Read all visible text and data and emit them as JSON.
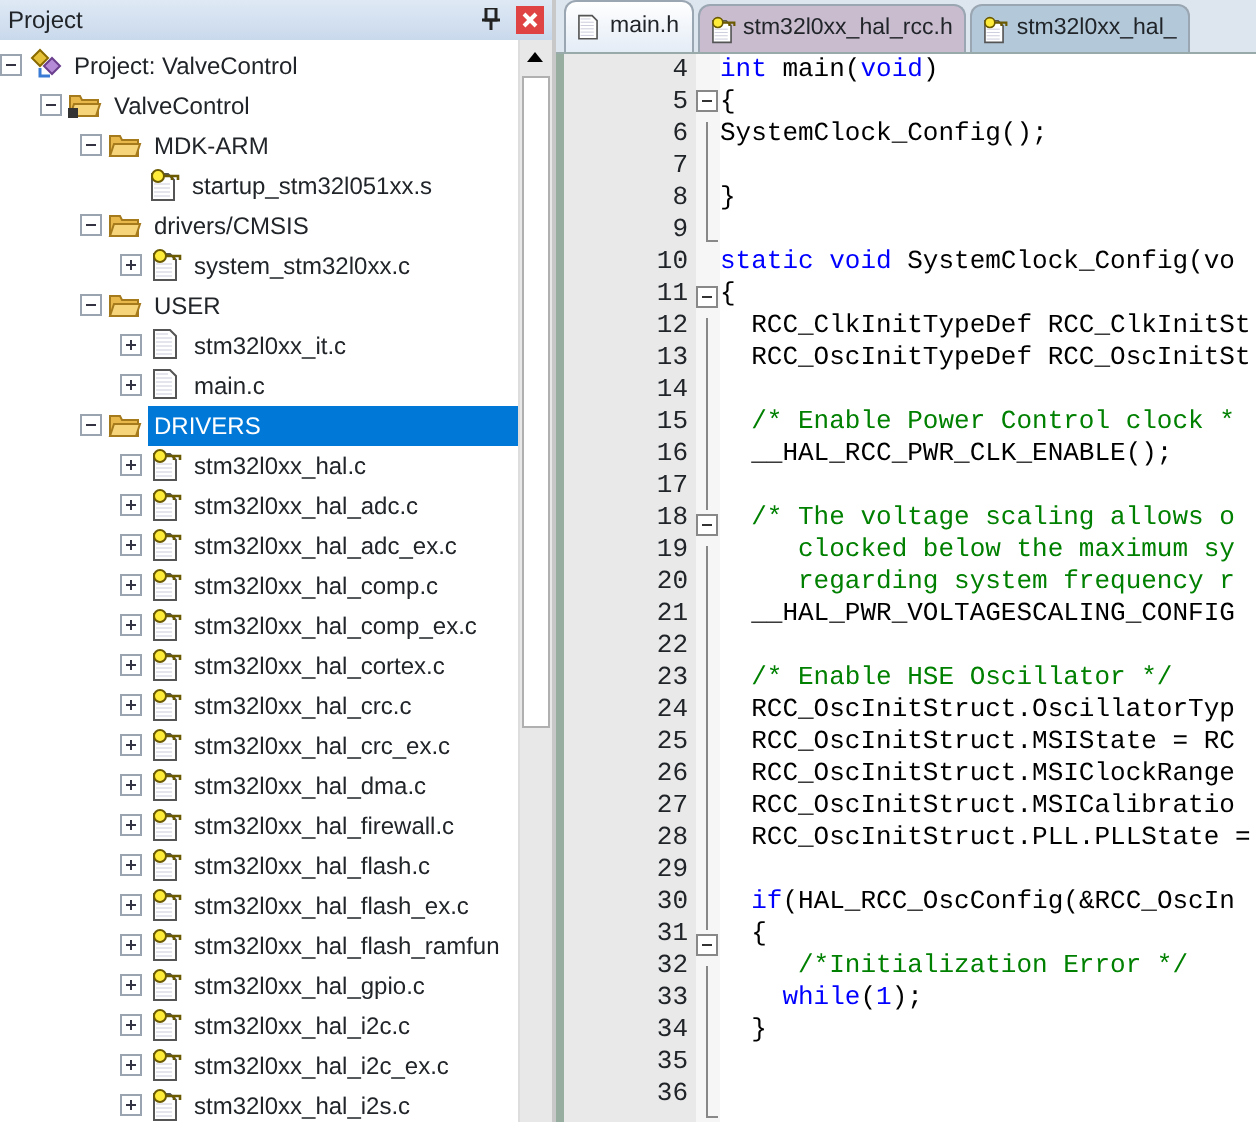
{
  "project_panel": {
    "title": "Project",
    "tree": [
      {
        "label": "Project: ValveControl",
        "kind": "project",
        "expanded": true,
        "selected": false,
        "children": [
          {
            "label": "ValveControl",
            "kind": "target",
            "expanded": true,
            "selected": false,
            "children": [
              {
                "label": "MDK-ARM",
                "kind": "folder",
                "expanded": true,
                "selected": false,
                "children": [
                  {
                    "label": "startup_stm32l051xx.s",
                    "kind": "file-key",
                    "selected": false
                  }
                ]
              },
              {
                "label": "drivers/CMSIS",
                "kind": "folder",
                "expanded": true,
                "selected": false,
                "children": [
                  {
                    "label": "system_stm32l0xx.c",
                    "kind": "file-key",
                    "expanded": false,
                    "selected": false
                  }
                ]
              },
              {
                "label": "USER",
                "kind": "folder",
                "expanded": true,
                "selected": false,
                "children": [
                  {
                    "label": "stm32l0xx_it.c",
                    "kind": "file",
                    "expanded": false,
                    "selected": false
                  },
                  {
                    "label": "main.c",
                    "kind": "file",
                    "expanded": false,
                    "selected": false
                  }
                ]
              },
              {
                "label": "DRIVERS",
                "kind": "folder",
                "expanded": true,
                "selected": true,
                "children": [
                  {
                    "label": "stm32l0xx_hal.c",
                    "kind": "file-key",
                    "expanded": false,
                    "selected": false
                  },
                  {
                    "label": "stm32l0xx_hal_adc.c",
                    "kind": "file-key",
                    "expanded": false,
                    "selected": false
                  },
                  {
                    "label": "stm32l0xx_hal_adc_ex.c",
                    "kind": "file-key",
                    "expanded": false,
                    "selected": false
                  },
                  {
                    "label": "stm32l0xx_hal_comp.c",
                    "kind": "file-key",
                    "expanded": false,
                    "selected": false
                  },
                  {
                    "label": "stm32l0xx_hal_comp_ex.c",
                    "kind": "file-key",
                    "expanded": false,
                    "selected": false
                  },
                  {
                    "label": "stm32l0xx_hal_cortex.c",
                    "kind": "file-key",
                    "expanded": false,
                    "selected": false
                  },
                  {
                    "label": "stm32l0xx_hal_crc.c",
                    "kind": "file-key",
                    "expanded": false,
                    "selected": false
                  },
                  {
                    "label": "stm32l0xx_hal_crc_ex.c",
                    "kind": "file-key",
                    "expanded": false,
                    "selected": false
                  },
                  {
                    "label": "stm32l0xx_hal_dma.c",
                    "kind": "file-key",
                    "expanded": false,
                    "selected": false
                  },
                  {
                    "label": "stm32l0xx_hal_firewall.c",
                    "kind": "file-key",
                    "expanded": false,
                    "selected": false
                  },
                  {
                    "label": "stm32l0xx_hal_flash.c",
                    "kind": "file-key",
                    "expanded": false,
                    "selected": false
                  },
                  {
                    "label": "stm32l0xx_hal_flash_ex.c",
                    "kind": "file-key",
                    "expanded": false,
                    "selected": false
                  },
                  {
                    "label": "stm32l0xx_hal_flash_ramfun",
                    "kind": "file-key",
                    "expanded": false,
                    "selected": false
                  },
                  {
                    "label": "stm32l0xx_hal_gpio.c",
                    "kind": "file-key",
                    "expanded": false,
                    "selected": false
                  },
                  {
                    "label": "stm32l0xx_hal_i2c.c",
                    "kind": "file-key",
                    "expanded": false,
                    "selected": false
                  },
                  {
                    "label": "stm32l0xx_hal_i2c_ex.c",
                    "kind": "file-key",
                    "expanded": false,
                    "selected": false
                  },
                  {
                    "label": "stm32l0xx_hal_i2s.c",
                    "kind": "file-key",
                    "expanded": false,
                    "selected": false
                  }
                ]
              }
            ]
          }
        ]
      }
    ]
  },
  "editor": {
    "tabs": [
      {
        "label": "main.h",
        "kind": "file",
        "selected": true,
        "color": "#e4ecf6"
      },
      {
        "label": "stm32l0xx_hal_rcc.h",
        "kind": "file-key",
        "selected": false,
        "color": "#c9bccf"
      },
      {
        "label": "stm32l0xx_hal_",
        "kind": "file-key",
        "selected": false,
        "color": "#b3c9da"
      }
    ],
    "lines": [
      {
        "number": "4",
        "kind": "plain",
        "segments": [
          {
            "kind": "keyword",
            "text": "int"
          },
          {
            "kind": "plain",
            "text": " main("
          },
          {
            "kind": "keyword",
            "text": "void"
          },
          {
            "kind": "plain",
            "text": ")"
          }
        ]
      },
      {
        "number": "5",
        "kind": "fold-start",
        "segments": [
          {
            "kind": "plain",
            "text": "{"
          }
        ]
      },
      {
        "number": "6",
        "kind": "fold-inner",
        "segments": [
          {
            "kind": "plain",
            "text": "SystemClock_Config();"
          }
        ]
      },
      {
        "number": "7",
        "kind": "fold-inner"
      },
      {
        "number": "8",
        "kind": "fold-inner",
        "segments": [
          {
            "kind": "plain",
            "text": "}"
          }
        ]
      },
      {
        "number": "9",
        "kind": "fold-end"
      },
      {
        "number": "10",
        "kind": "plain",
        "segments": [
          {
            "kind": "keyword",
            "text": "static void"
          },
          {
            "kind": "plain",
            "text": " SystemClock_Config(vo"
          }
        ]
      },
      {
        "number": "11",
        "kind": "fold-start",
        "segments": [
          {
            "kind": "plain",
            "text": "{"
          }
        ]
      },
      {
        "number": "12",
        "kind": "fold-inner",
        "segments": [
          {
            "kind": "plain",
            "text": "  RCC_ClkInitTypeDef RCC_ClkInitSt"
          }
        ]
      },
      {
        "number": "13",
        "kind": "fold-inner",
        "segments": [
          {
            "kind": "plain",
            "text": "  RCC_OscInitTypeDef RCC_OscInitSt"
          }
        ]
      },
      {
        "number": "14",
        "kind": "fold-inner"
      },
      {
        "number": "15",
        "kind": "fold-inner",
        "segments": [
          {
            "kind": "comment",
            "text": "  /* Enable Power Control clock *"
          }
        ]
      },
      {
        "number": "16",
        "kind": "fold-inner",
        "segments": [
          {
            "kind": "plain",
            "text": "  __HAL_RCC_PWR_CLK_ENABLE();"
          }
        ]
      },
      {
        "number": "17",
        "kind": "fold-inner"
      },
      {
        "number": "18",
        "kind": "fold-start",
        "segments": [
          {
            "kind": "comment",
            "text": "  /* The voltage scaling allows o"
          }
        ]
      },
      {
        "number": "19",
        "kind": "fold-inner",
        "segments": [
          {
            "kind": "comment",
            "text": "     clocked below the maximum sy"
          }
        ]
      },
      {
        "number": "20",
        "kind": "fold-inner",
        "segments": [
          {
            "kind": "comment",
            "text": "     regarding system frequency r"
          }
        ]
      },
      {
        "number": "21",
        "kind": "fold-inner",
        "segments": [
          {
            "kind": "plain",
            "text": "  __HAL_PWR_VOLTAGESCALING_CONFIG"
          }
        ]
      },
      {
        "number": "22",
        "kind": "fold-inner"
      },
      {
        "number": "23",
        "kind": "fold-inner",
        "segments": [
          {
            "kind": "comment",
            "text": "  /* Enable HSE Oscillator */"
          }
        ]
      },
      {
        "number": "24",
        "kind": "fold-inner",
        "segments": [
          {
            "kind": "plain",
            "text": "  RCC_OscInitStruct.OscillatorTyp"
          }
        ]
      },
      {
        "number": "25",
        "kind": "fold-inner",
        "segments": [
          {
            "kind": "plain",
            "text": "  RCC_OscInitStruct.MSIState = RC"
          }
        ]
      },
      {
        "number": "26",
        "kind": "fold-inner",
        "segments": [
          {
            "kind": "plain",
            "text": "  RCC_OscInitStruct.MSIClockRange"
          }
        ]
      },
      {
        "number": "27",
        "kind": "fold-inner",
        "segments": [
          {
            "kind": "plain",
            "text": "  RCC_OscInitStruct.MSICalibratio"
          }
        ]
      },
      {
        "number": "28",
        "kind": "fold-inner",
        "segments": [
          {
            "kind": "plain",
            "text": "  RCC_OscInitStruct.PLL.PLLState ="
          }
        ]
      },
      {
        "number": "29",
        "kind": "fold-inner"
      },
      {
        "number": "30",
        "kind": "fold-inner",
        "segments": [
          {
            "kind": "keyword",
            "text": "  if"
          },
          {
            "kind": "plain",
            "text": "(HAL_RCC_OscConfig(&RCC_OscIn"
          }
        ]
      },
      {
        "number": "31",
        "kind": "fold-start",
        "segments": [
          {
            "kind": "plain",
            "text": "  {"
          }
        ]
      },
      {
        "number": "32",
        "kind": "fold-inner",
        "segments": [
          {
            "kind": "comment",
            "text": "     /*Initialization Error */"
          }
        ]
      },
      {
        "number": "33",
        "kind": "fold-inner",
        "segments": [
          {
            "kind": "keyword",
            "text": "    while"
          },
          {
            "kind": "plain",
            "text": "("
          },
          {
            "kind": "number",
            "text": "1"
          },
          {
            "kind": "plain",
            "text": ");"
          }
        ]
      },
      {
        "number": "34",
        "kind": "fold-inner",
        "segments": [
          {
            "kind": "plain",
            "text": "  }"
          }
        ]
      },
      {
        "number": "35",
        "kind": "fold-inner"
      },
      {
        "number": "36",
        "kind": "fold-end"
      }
    ]
  }
}
